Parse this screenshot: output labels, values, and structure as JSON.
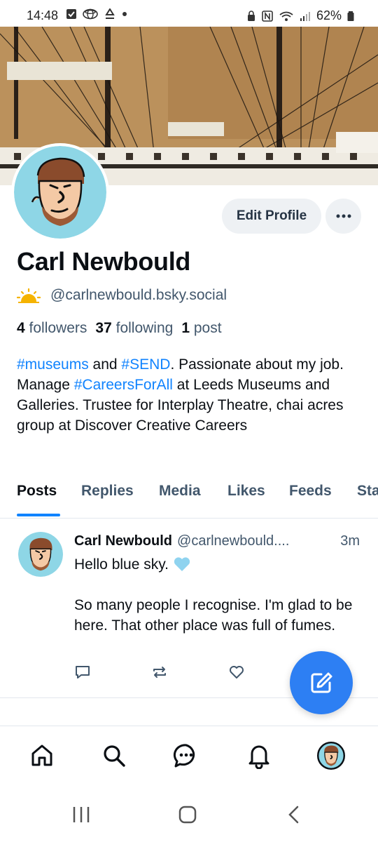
{
  "status_bar": {
    "time": "14:48",
    "battery": "62%"
  },
  "profile": {
    "display_name": "Carl Newbould",
    "handle": "@carlnewbould.bsky.social",
    "followers_count": "4",
    "followers_label": "followers",
    "following_count": "37",
    "following_label": "following",
    "posts_count": "1",
    "posts_label": "post",
    "edit_button": "Edit Profile",
    "bio": {
      "tag1": "#museums",
      "t1": " and ",
      "tag2": "#SEND",
      "t2": ". Passionate about my job. Manage ",
      "tag3": "#CareersForAll",
      "t3": " at Leeds Museums and Galleries. Trustee for Interplay Theatre, chai acres group at Discover Creative Careers"
    }
  },
  "tabs": [
    "Posts",
    "Replies",
    "Media",
    "Likes",
    "Feeds",
    "Sta"
  ],
  "post": {
    "author": "Carl Newbould",
    "handle": "@carlnewbould....",
    "time": "3m",
    "text_line1": "Hello blue sky.",
    "text_rest": "So many people I recognise. I'm glad to be here. That other place was full of fumes."
  },
  "colors": {
    "accent": "#1083fe",
    "fab": "#2d7ff3",
    "muted_text": "#42576c"
  },
  "icons": {
    "reply": "speech-bubble-icon",
    "repost": "repost-icon",
    "like": "heart-icon",
    "compose": "compose-icon",
    "nav": [
      "home-icon",
      "search-icon",
      "chat-icon",
      "bell-icon",
      "avatar"
    ]
  }
}
